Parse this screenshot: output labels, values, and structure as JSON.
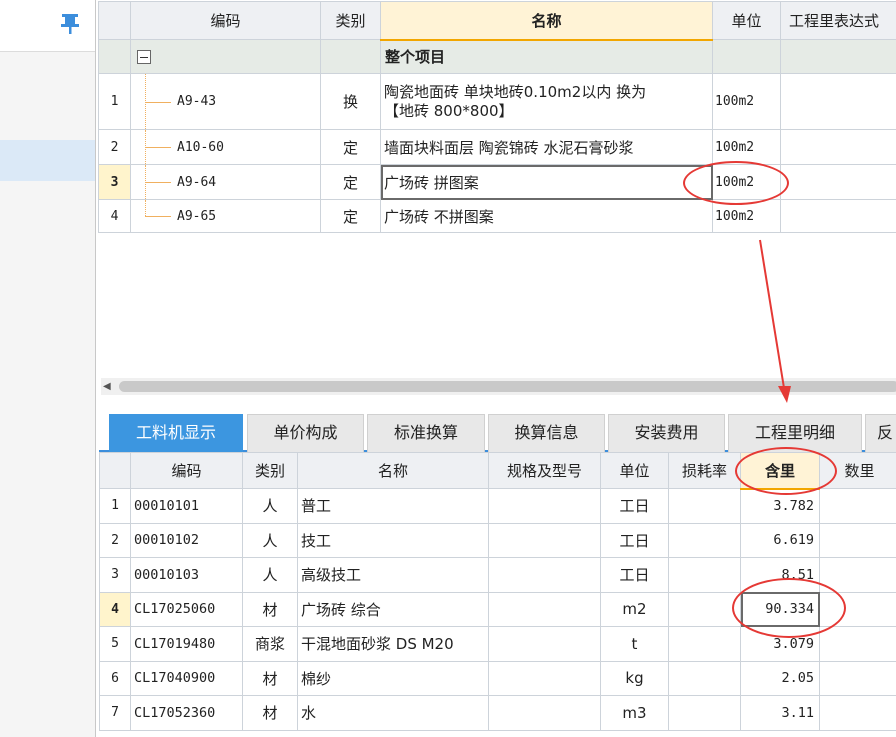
{
  "top_table": {
    "headers": {
      "code": "编码",
      "category": "类别",
      "name": "名称",
      "unit": "单位",
      "expression": "工程里表达式"
    },
    "group_row": {
      "name": "整个项目"
    },
    "rows": [
      {
        "num": "1",
        "code": "A9-43",
        "category": "换",
        "name_line1": "陶瓷地面砖 单块地砖0.10m2以内  换为",
        "name_line2": "【地砖 800*800】",
        "unit": "100m2"
      },
      {
        "num": "2",
        "code": "A10-60",
        "category": "定",
        "name_line1": "墙面块料面层 陶瓷锦砖 水泥石膏砂浆",
        "unit": "100m2"
      },
      {
        "num": "3",
        "code": "A9-64",
        "category": "定",
        "name_line1": "广场砖 拼图案",
        "unit": "100m2"
      },
      {
        "num": "4",
        "code": "A9-65",
        "category": "定",
        "name_line1": "广场砖 不拼图案",
        "unit": "100m2"
      }
    ]
  },
  "tabs": [
    {
      "label": "工料机显示"
    },
    {
      "label": "单价构成"
    },
    {
      "label": "标准换算"
    },
    {
      "label": "换算信息"
    },
    {
      "label": "安装费用"
    },
    {
      "label": "工程里明细"
    },
    {
      "label": "反"
    }
  ],
  "bottom_table": {
    "headers": {
      "code": "编码",
      "category": "类别",
      "name": "名称",
      "spec": "规格及型号",
      "unit": "单位",
      "loss": "损耗率",
      "content": "含里",
      "quantity": "数里"
    },
    "rows": [
      {
        "num": "1",
        "code": "00010101",
        "category": "人",
        "name": "普工",
        "unit": "工日",
        "content": "3.782"
      },
      {
        "num": "2",
        "code": "00010102",
        "category": "人",
        "name": "技工",
        "unit": "工日",
        "content": "6.619"
      },
      {
        "num": "3",
        "code": "00010103",
        "category": "人",
        "name": "高级技工",
        "unit": "工日",
        "content": "8.51"
      },
      {
        "num": "4",
        "code": "CL17025060",
        "category": "材",
        "name": "广场砖 综合",
        "unit": "m2",
        "content": "90.334"
      },
      {
        "num": "5",
        "code": "CL17019480",
        "category": "商浆",
        "name": "干混地面砂浆 DS M20",
        "unit": "t",
        "content": "3.079"
      },
      {
        "num": "6",
        "code": "CL17040900",
        "category": "材",
        "name": "棉纱",
        "unit": "kg",
        "content": "2.05"
      },
      {
        "num": "7",
        "code": "CL17052360",
        "category": "材",
        "name": "水",
        "unit": "m3",
        "content": "3.11"
      }
    ]
  },
  "colors": {
    "accent": "#3c96e0",
    "annotation": "#e53935",
    "header_highlight": "#fff3d6"
  }
}
